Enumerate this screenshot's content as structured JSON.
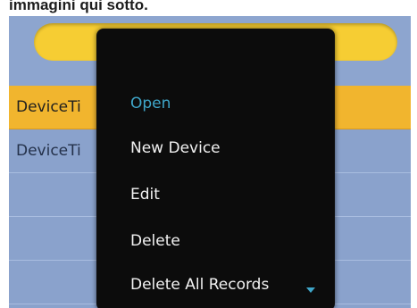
{
  "caption": "immagini qui sotto.",
  "search": {
    "value": ""
  },
  "list": {
    "rows": [
      {
        "label": "DeviceTi"
      },
      {
        "label": "DeviceTi"
      }
    ]
  },
  "menu": {
    "items": [
      {
        "label": "Open",
        "highlighted": true
      },
      {
        "label": "New Device"
      },
      {
        "label": "Edit"
      },
      {
        "label": "Delete"
      },
      {
        "label": "Delete All Records"
      }
    ],
    "scroll_icon": "chevron-down-icon"
  },
  "colors": {
    "selection": "#f1b52e",
    "search_pill": "#f6cd33",
    "menu_bg": "#0c0c0c",
    "highlight_text": "#3fa6c9",
    "screen_bg": "#8aa2cc"
  }
}
